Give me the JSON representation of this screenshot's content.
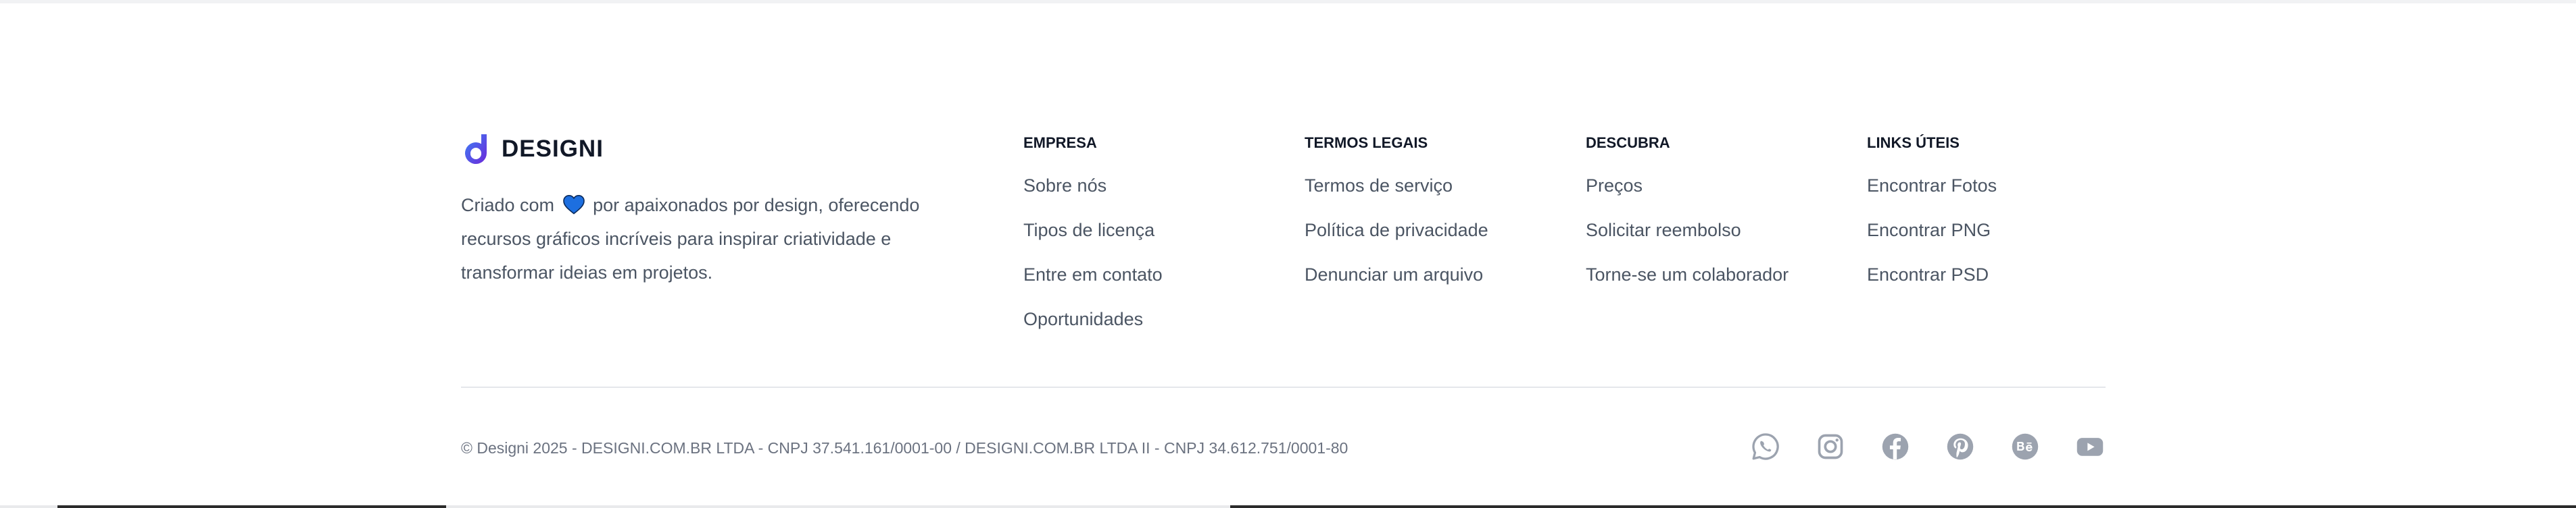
{
  "brand": {
    "name": "DESIGNI",
    "tagline_before": "Criado com",
    "tagline_after": "por apaixonados por design, oferecendo recursos gráficos incríveis para inspirar criatividade e transformar ideias em projetos."
  },
  "columns": [
    {
      "title": "EMPRESA",
      "links": [
        "Sobre nós",
        "Tipos de licença",
        "Entre em contato",
        "Oportunidades"
      ]
    },
    {
      "title": "TERMOS LEGAIS",
      "links": [
        "Termos de serviço",
        "Política de privacidade",
        "Denunciar um arquivo"
      ]
    },
    {
      "title": "DESCUBRA",
      "links": [
        "Preços",
        "Solicitar reembolso",
        "Torne-se um colaborador"
      ]
    },
    {
      "title": "LINKS ÚTEIS",
      "links": [
        "Encontrar Fotos",
        "Encontrar PNG",
        "Encontrar PSD"
      ]
    }
  ],
  "copyright": "© Designi 2025 - DESIGNI.COM.BR LTDA - CNPJ 37.541.161/0001-00 / DESIGNI.COM.BR LTDA II - CNPJ 34.612.751/0001-80",
  "socials": [
    "whatsapp-icon",
    "instagram-icon",
    "facebook-icon",
    "pinterest-icon",
    "behance-icon",
    "youtube-icon"
  ],
  "colors": {
    "brand_gradient_start": "#3b82f6",
    "brand_gradient_end": "#6d28d9",
    "heart": "#1d6fe0",
    "heading": "#111827",
    "text": "#4b5563",
    "icon": "#9ca3af",
    "divider": "#e5e7eb"
  }
}
